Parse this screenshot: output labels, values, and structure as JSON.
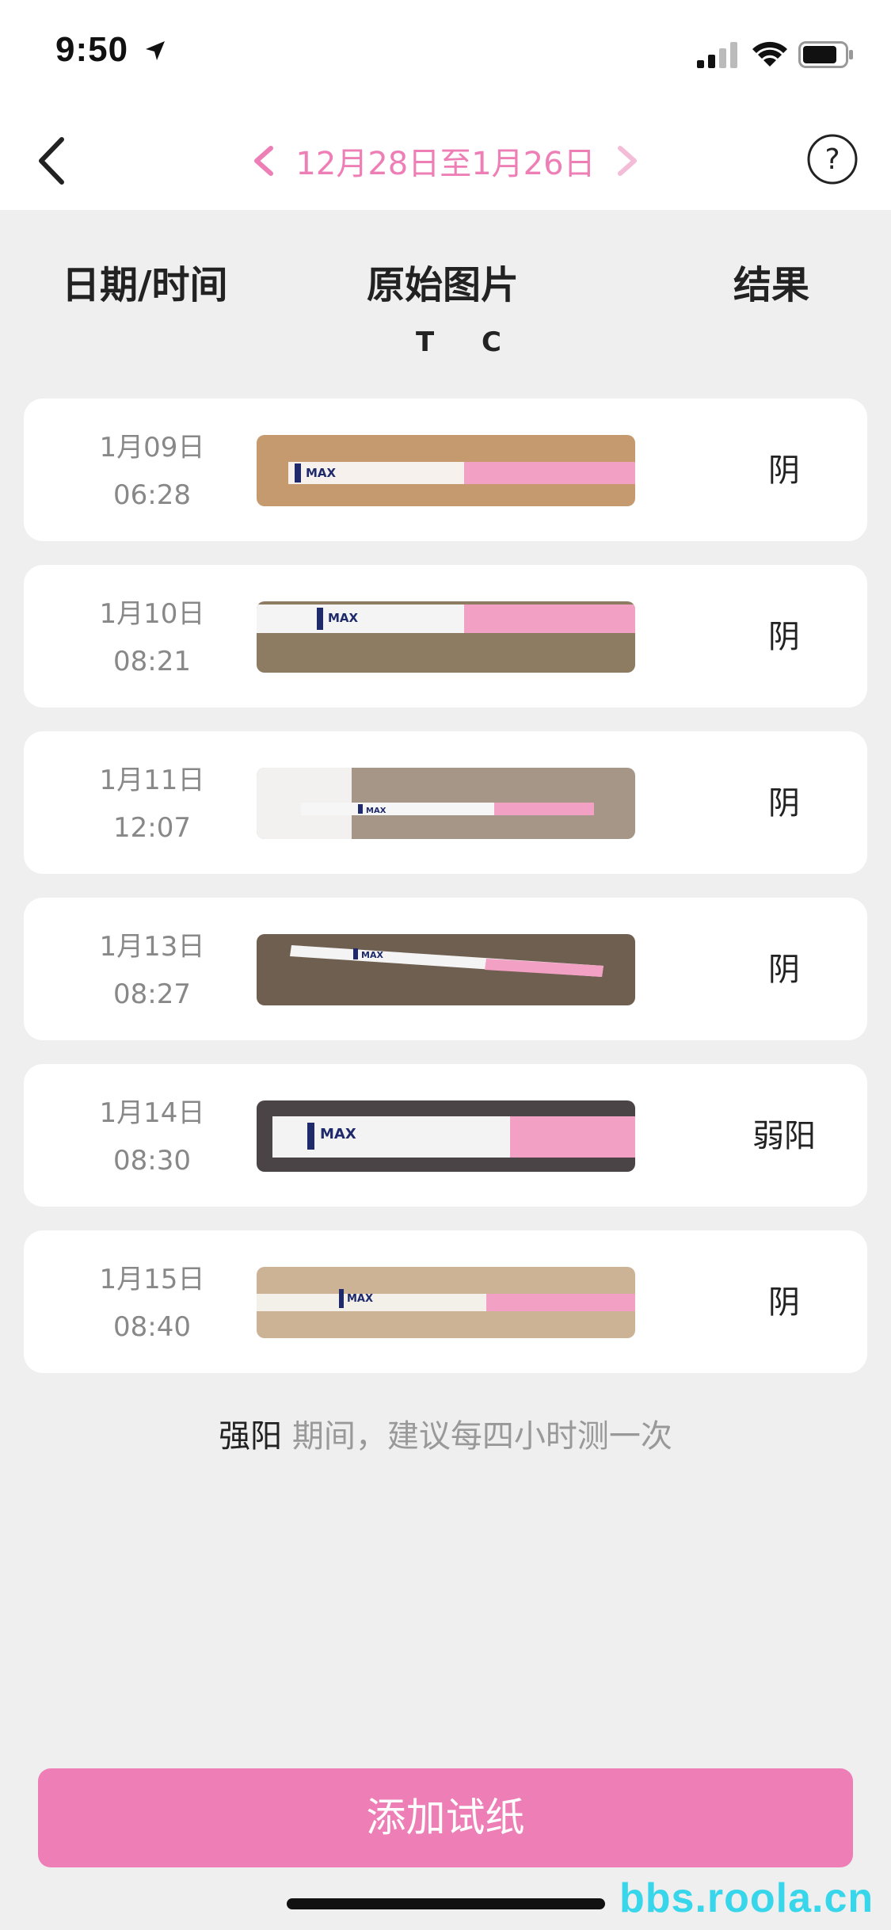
{
  "status_bar": {
    "time": "9:50"
  },
  "nav": {
    "range_label": "12月28日至1月26日",
    "help_label": "?"
  },
  "table_header": {
    "date_time": "日期/时间",
    "image": "原始图片",
    "result": "结果",
    "tc": "T C"
  },
  "rows": [
    {
      "date": "1月09日",
      "time": "06:28",
      "result": "阴"
    },
    {
      "date": "1月10日",
      "time": "08:21",
      "result": "阴"
    },
    {
      "date": "1月11日",
      "time": "12:07",
      "result": "阴"
    },
    {
      "date": "1月13日",
      "time": "08:27",
      "result": "阴"
    },
    {
      "date": "1月14日",
      "time": "08:30",
      "result": "弱阳"
    },
    {
      "date": "1月15日",
      "time": "08:40",
      "result": "阴"
    }
  ],
  "strip_images": [
    {
      "background": "#c59a6f",
      "label": "MAX"
    },
    {
      "background": "#8d7b62",
      "label": "MAX"
    },
    {
      "background": "#a59687",
      "label": "MAX"
    },
    {
      "background": "#6f5f50",
      "label": "MAX"
    },
    {
      "background": "#4a4446",
      "label": "MAX"
    },
    {
      "background": "#cdb395",
      "label": "MAX"
    }
  ],
  "hint": {
    "strong": "强阳",
    "text": " 期间，建议每四小时测一次"
  },
  "add_button": {
    "label": "添加试纸"
  },
  "watermark": {
    "text": "bbs.roola.cn"
  },
  "colors": {
    "accent": "#ee7fb6",
    "background": "#efefef"
  }
}
